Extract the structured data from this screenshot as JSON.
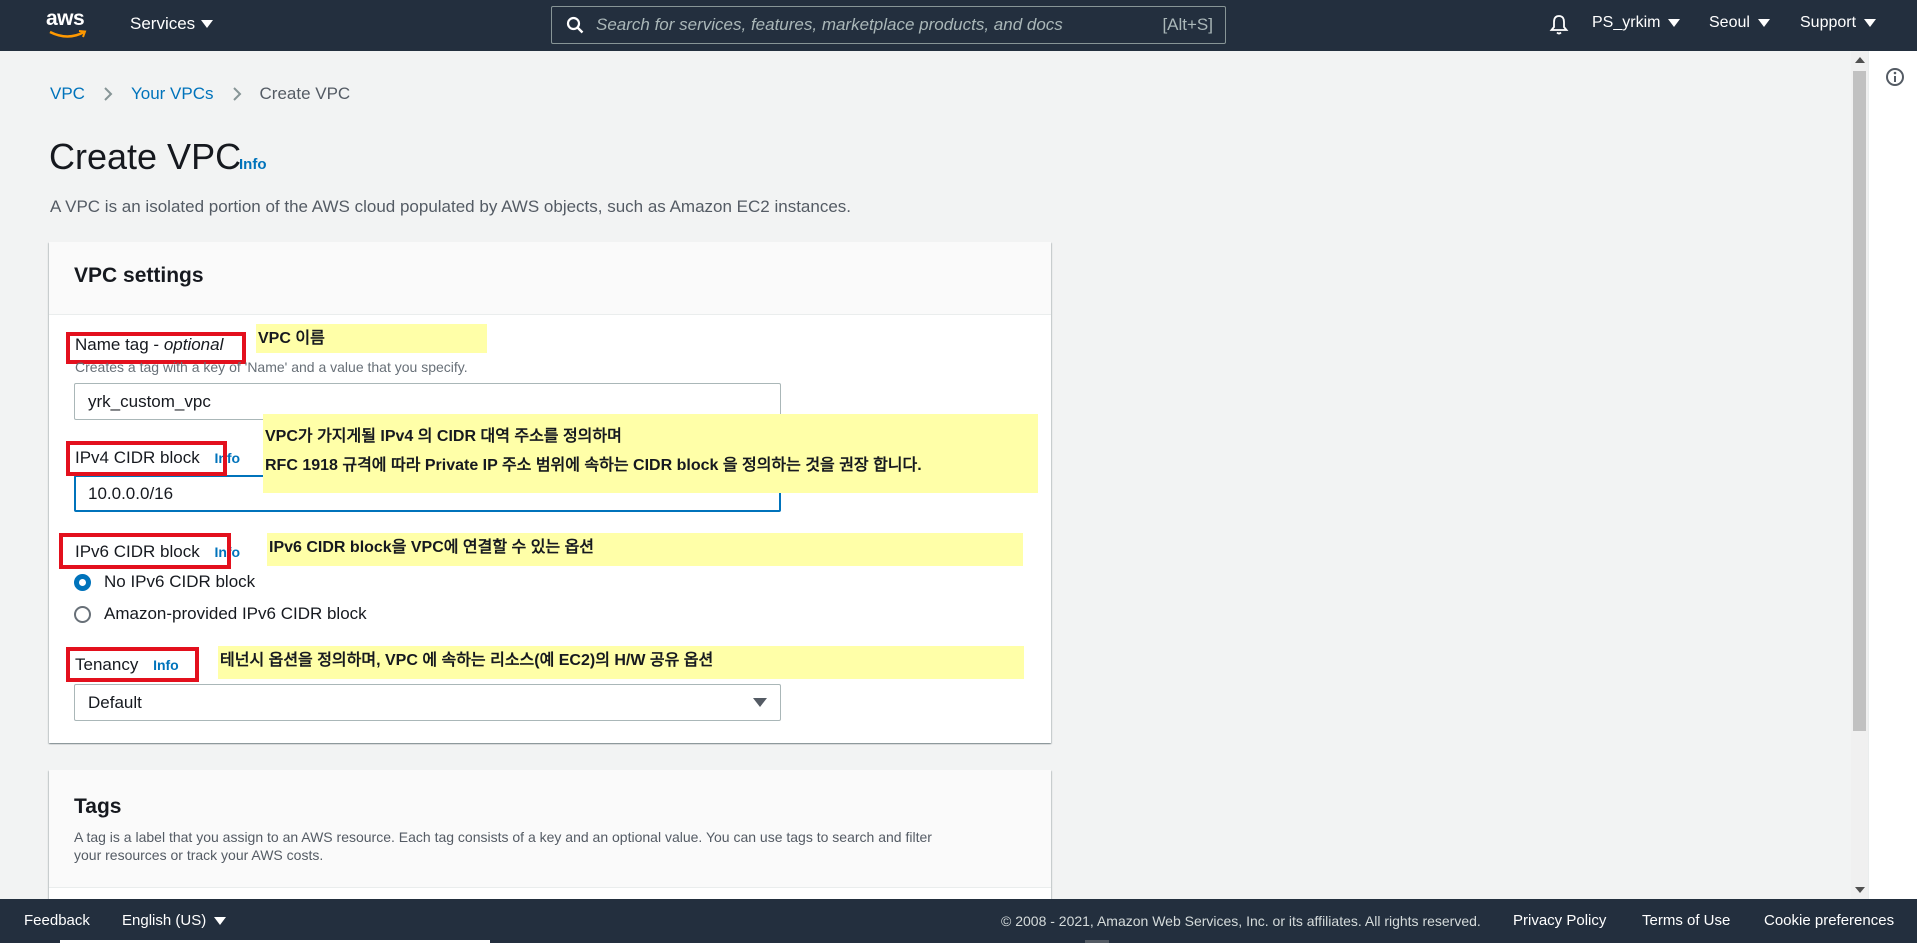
{
  "nav": {
    "logo_text": "aws",
    "services_label": "Services",
    "search_placeholder": "Search for services, features, marketplace products, and docs",
    "search_shortcut": "[Alt+S]",
    "user_label": "PS_yrkim",
    "region_label": "Seoul",
    "support_label": "Support"
  },
  "breadcrumb": {
    "items": [
      "VPC",
      "Your VPCs"
    ],
    "current": "Create VPC"
  },
  "page": {
    "title": "Create VPC",
    "info_label": "Info",
    "description": "A VPC is an isolated portion of the AWS cloud populated by AWS objects, such as Amazon EC2 instances."
  },
  "vpc_settings": {
    "title": "VPC settings",
    "name_tag": {
      "label": "Name tag - ",
      "label_optional": "optional",
      "description": "Creates a tag with a key of 'Name' and a value that you specify.",
      "value": "yrk_custom_vpc"
    },
    "ipv4": {
      "label": "IPv4 CIDR block",
      "info_label": "Info",
      "value": "10.0.0.0/16"
    },
    "ipv6": {
      "label": "IPv6 CIDR block",
      "info_label": "Info",
      "options": [
        "No IPv6 CIDR block",
        "Amazon-provided IPv6 CIDR block"
      ],
      "selected_index": 0
    },
    "tenancy": {
      "label": "Tenancy",
      "info_label": "Info",
      "value": "Default"
    }
  },
  "annotations": {
    "name_tag_note": "VPC 이름",
    "ipv4_note_line1": "VPC가 가지게될 IPv4 의 CIDR 대역 주소를 정의하며",
    "ipv4_note_line2": "RFC 1918 규격에 따라 Private IP 주소 범위에 속하는 CIDR block 을 정의하는 것을 권장 합니다.",
    "ipv6_note": "IPv6 CIDR block을 VPC에 연결할 수 있는 옵션",
    "tenancy_note": "테넌시 옵션을 정의하며, VPC 에 속하는 리소스(예 EC2)의 H/W 공유 옵션",
    "highlight_color": "#ffffa8",
    "box_color": "#e3101d"
  },
  "tags_panel": {
    "title": "Tags",
    "description_line1": "A tag is a label that you assign to an AWS resource. Each tag consists of a key and an optional value. You can use tags to search and filter",
    "description_line2": "your resources or track your AWS costs."
  },
  "footer": {
    "feedback": "Feedback",
    "language": "English (US)",
    "copyright": "© 2008 - 2021, Amazon Web Services, Inc. or its affiliates. All rights reserved.",
    "privacy": "Privacy Policy",
    "terms": "Terms of Use",
    "cookies": "Cookie preferences"
  },
  "colors": {
    "nav_bg": "#232f3e",
    "link": "#0073bb",
    "page_bg": "#f2f3f3",
    "smile": "#ff9900"
  }
}
